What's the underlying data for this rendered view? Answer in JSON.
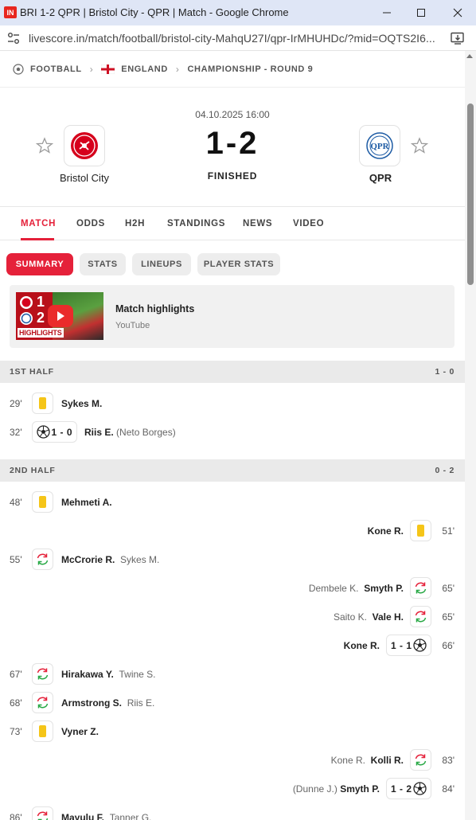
{
  "window": {
    "favicon": "IN",
    "title": "BRI 1-2 QPR | Bristol City - QPR | Match - Google Chrome",
    "url": "livescore.in/match/football/bristol-city-MahqU27I/qpr-IrMHUHDc/?mid=OQTS2I6..."
  },
  "breadcrumb": {
    "sport": "FOOTBALL",
    "country": "ENGLAND",
    "league": "CHAMPIONSHIP - ROUND 9"
  },
  "match": {
    "datetime": "04.10.2025 16:00",
    "score": "1-2",
    "status": "FINISHED",
    "home": {
      "name": "Bristol City",
      "color": "#d6001c"
    },
    "away": {
      "name": "QPR",
      "color": "#1d5ba4"
    }
  },
  "tabs": [
    "MATCH",
    "ODDS",
    "H2H",
    "STANDINGS",
    "NEWS",
    "VIDEO"
  ],
  "subtabs": [
    "SUMMARY",
    "STATS",
    "LINEUPS",
    "PLAYER STATS"
  ],
  "highlight": {
    "title": "Match highlights",
    "source": "YouTube",
    "thumb_home": "1",
    "thumb_away": "2",
    "thumb_label": "HIGHLIGHTS"
  },
  "first_half": {
    "label": "1ST HALF",
    "score": "1 - 0"
  },
  "second_half": {
    "label": "2ND HALF",
    "score": "0 - 2"
  },
  "events": {
    "e1": {
      "minute": "29'",
      "player": "Sykes M.",
      "icon": "yellow-card"
    },
    "e2": {
      "minute": "32'",
      "player": "Riis E.",
      "assist": "(Neto Borges)",
      "score": "1 - 0",
      "icon": "goal-ball"
    },
    "e3": {
      "minute": "48'",
      "player": "Mehmeti A.",
      "icon": "yellow-card"
    },
    "e4": {
      "minute": "51'",
      "player": "Kone R.",
      "icon": "yellow-card"
    },
    "e5": {
      "minute": "55'",
      "player": "McCrorie R.",
      "secondary": "Sykes M.",
      "icon": "substitution"
    },
    "e6": {
      "minute": "65'",
      "player": "Smyth P.",
      "secondary": "Dembele K.",
      "icon": "substitution"
    },
    "e7": {
      "minute": "65'",
      "player": "Vale H.",
      "secondary": "Saito K.",
      "icon": "substitution"
    },
    "e8": {
      "minute": "66'",
      "player": "Kone R.",
      "score": "1 - 1",
      "icon": "goal-ball"
    },
    "e9": {
      "minute": "67'",
      "player": "Hirakawa Y.",
      "secondary": "Twine S.",
      "icon": "substitution"
    },
    "e10": {
      "minute": "68'",
      "player": "Armstrong S.",
      "secondary": "Riis E.",
      "icon": "substitution"
    },
    "e11": {
      "minute": "73'",
      "player": "Vyner Z.",
      "icon": "yellow-card"
    },
    "e12": {
      "minute": "83'",
      "player": "Kolli R.",
      "secondary": "Kone R.",
      "icon": "substitution"
    },
    "e13": {
      "minute": "84'",
      "player": "Smyth P.",
      "assist": "(Dunne J.)",
      "score": "1 - 2",
      "icon": "goal-ball"
    },
    "e14": {
      "minute": "86'",
      "player": "Mayulu F.",
      "secondary": "Tanner G.",
      "icon": "substitution"
    }
  }
}
